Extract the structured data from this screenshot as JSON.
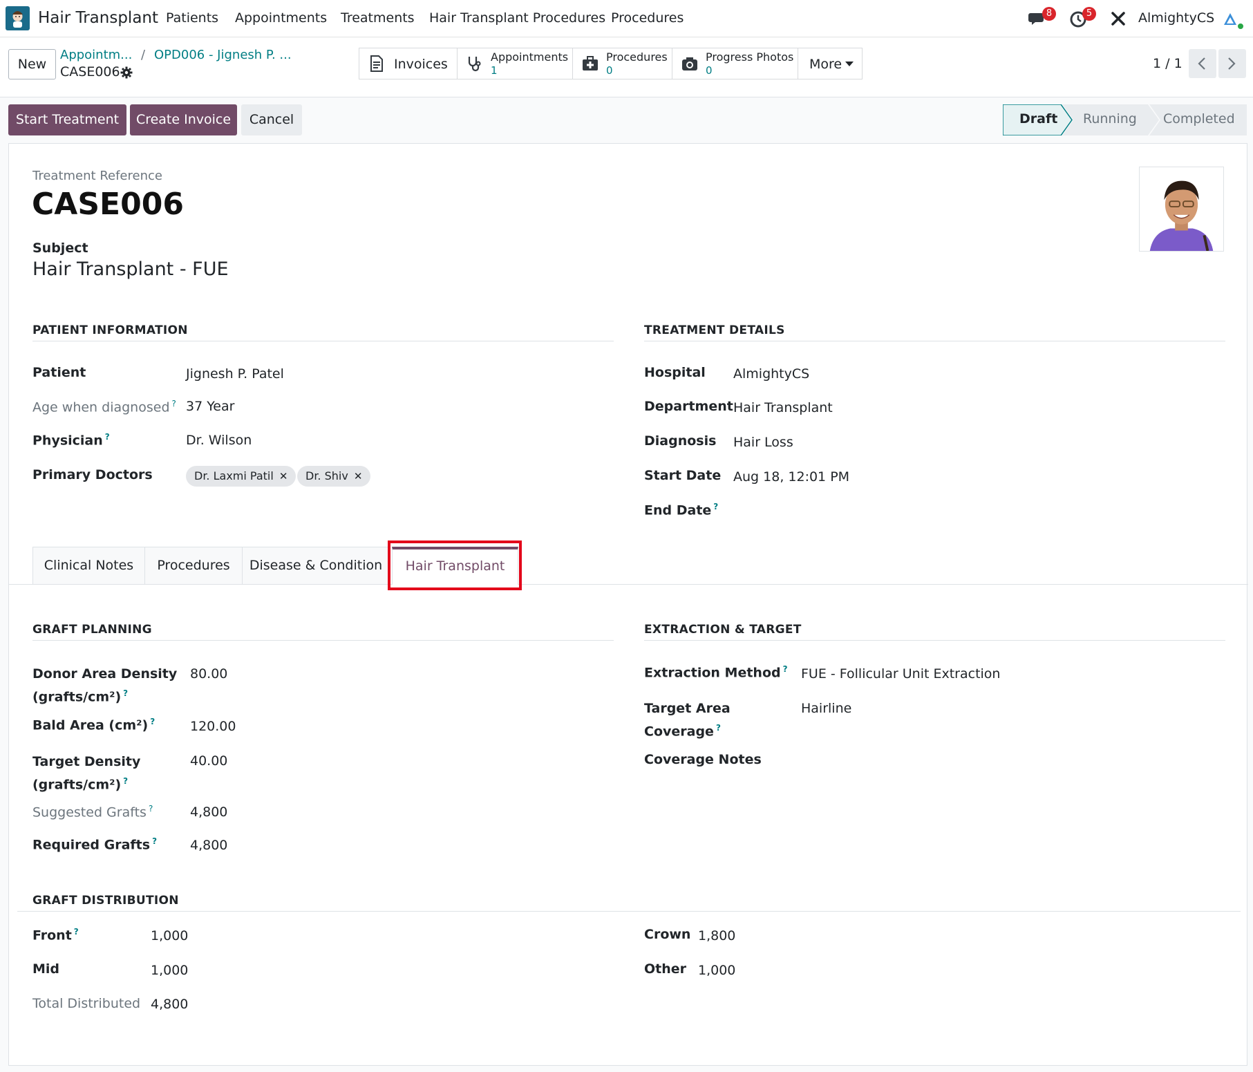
{
  "navbar": {
    "app_name": "Hair Transplant",
    "menus": [
      "Patients",
      "Appointments",
      "Treatments",
      "Hair Transplant Procedures",
      "Procedures"
    ],
    "messages_count": "8",
    "activities_count": "5",
    "company": "AlmightyCS"
  },
  "control": {
    "new_label": "New",
    "breadcrumb": [
      "Appointm...",
      "OPD006 - Jignesh P. ..."
    ],
    "breadcrumb_sep": "/",
    "current": "CASE006",
    "smart_buttons": {
      "invoices": "Invoices",
      "appointments": {
        "label": "Appointments",
        "value": "1"
      },
      "procedures": {
        "label": "Procedures",
        "value": "0"
      },
      "progress_photos": {
        "label": "Progress Photos",
        "value": "0"
      },
      "more": "More"
    },
    "pager": "1 / 1"
  },
  "actions": {
    "start_treatment": "Start Treatment",
    "create_invoice": "Create Invoice",
    "cancel": "Cancel"
  },
  "stages": [
    "Draft",
    "Running",
    "Completed"
  ],
  "form": {
    "reference_label": "Treatment Reference",
    "reference": "CASE006",
    "subject_label": "Subject",
    "subject": "Hair Transplant - FUE",
    "patient_info": {
      "title": "PATIENT INFORMATION",
      "patient_label": "Patient",
      "patient": "Jignesh P. Patel",
      "age_label": "Age when diagnosed",
      "age": "37 Year",
      "physician_label": "Physician",
      "physician": "Dr. Wilson",
      "primary_doctors_label": "Primary Doctors",
      "primary_doctors": [
        "Dr. Laxmi Patil",
        "Dr. Shiv"
      ]
    },
    "treatment_details": {
      "title": "TREATMENT DETAILS",
      "hospital_label": "Hospital",
      "hospital": "AlmightyCS",
      "department_label": "Department",
      "department": "Hair Transplant",
      "diagnosis_label": "Diagnosis",
      "diagnosis": "Hair Loss",
      "start_date_label": "Start Date",
      "start_date": "Aug 18, 12:01 PM",
      "end_date_label": "End Date"
    },
    "tabs": [
      "Clinical Notes",
      "Procedures",
      "Disease & Condition",
      "Hair Transplant"
    ],
    "graft_planning": {
      "title": "GRAFT PLANNING",
      "donor_density_label_1": "Donor Area Density",
      "donor_density_label_2": "(grafts/cm²)",
      "donor_density": "80.00",
      "bald_area_label": "Bald Area (cm²)",
      "bald_area": "120.00",
      "target_density_label_1": "Target Density",
      "target_density_label_2": "(grafts/cm²)",
      "target_density": "40.00",
      "suggested_label": "Suggested Grafts",
      "suggested": "4,800",
      "required_label": "Required Grafts",
      "required": "4,800"
    },
    "extraction": {
      "title": "EXTRACTION & TARGET",
      "method_label": "Extraction Method",
      "method": "FUE - Follicular Unit Extraction",
      "target_label_1": "Target Area",
      "target_label_2": "Coverage",
      "target": "Hairline",
      "notes_label": "Coverage Notes"
    },
    "distribution": {
      "title": "GRAFT DISTRIBUTION",
      "front_label": "Front",
      "front": "1,000",
      "mid_label": "Mid",
      "mid": "1,000",
      "total_label": "Total Distributed",
      "total": "4,800",
      "crown_label": "Crown",
      "crown": "1,800",
      "other_label": "Other",
      "other": "1,000"
    }
  },
  "colors": {
    "primary": "#714b67",
    "link": "#017e84",
    "badge": "#d9252b",
    "highlight": "#e3061b"
  }
}
